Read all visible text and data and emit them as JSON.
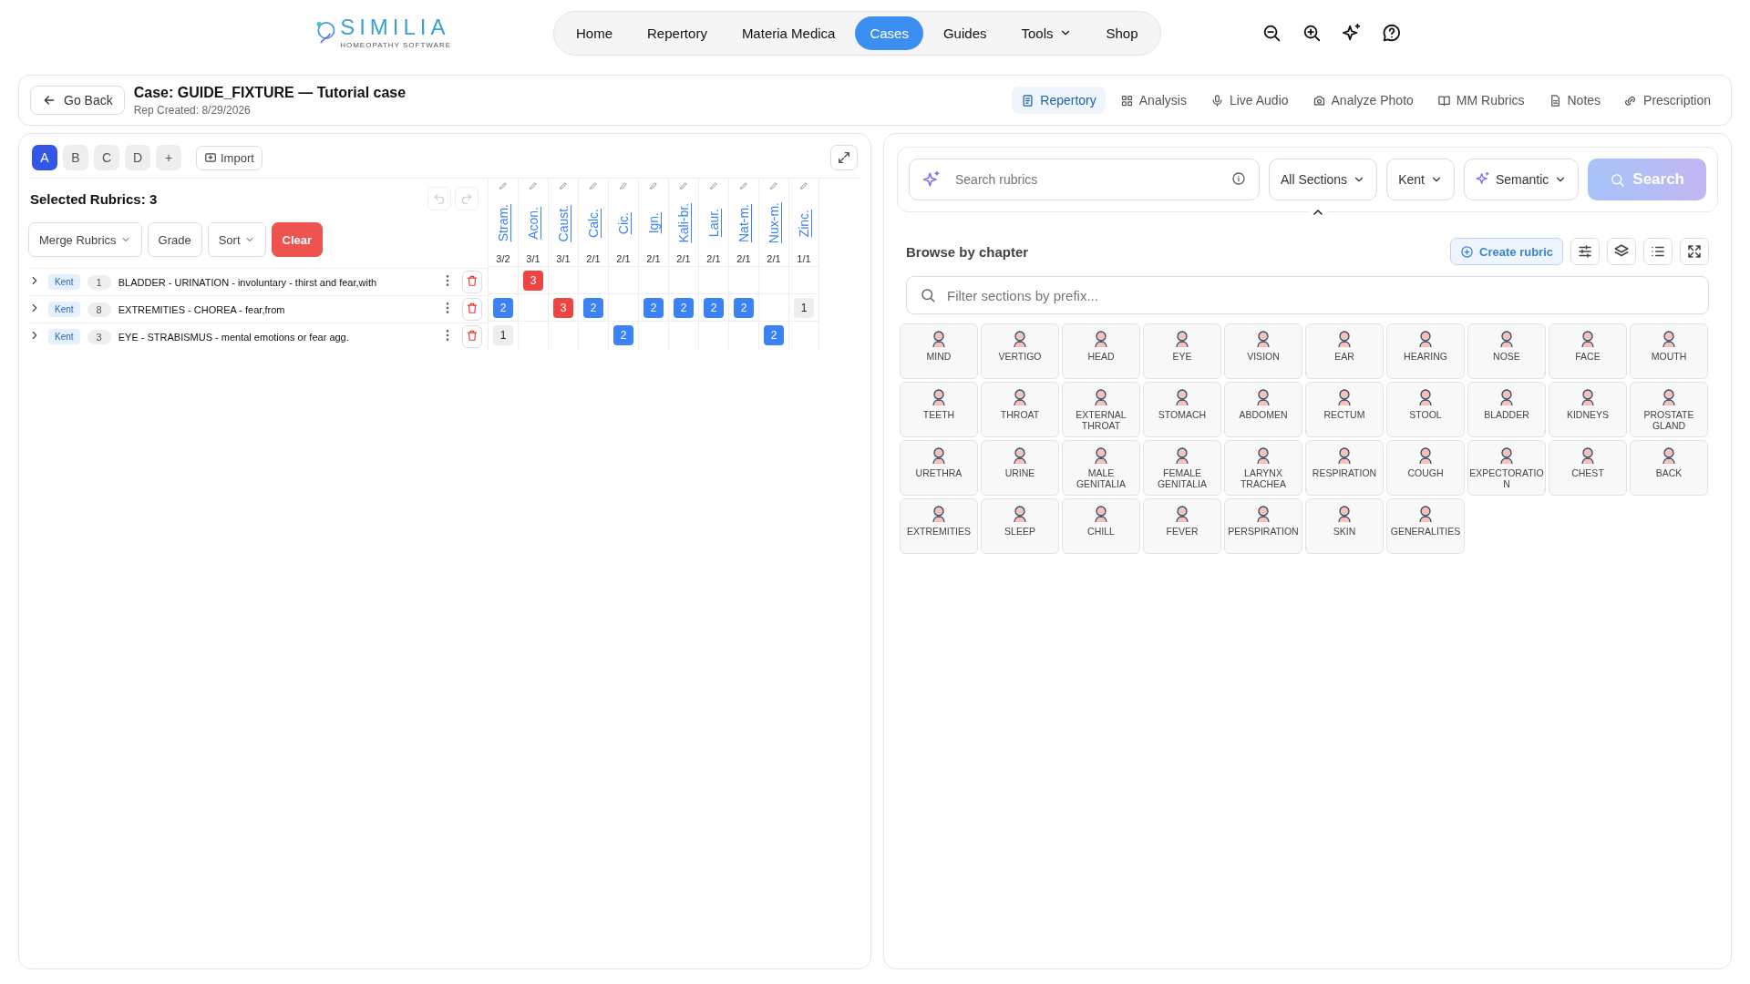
{
  "logo": {
    "name": "SIMILIA",
    "tagline": "HOMEOPATHY SOFTWARE"
  },
  "nav": [
    {
      "label": "Home",
      "selected": false,
      "menu": false
    },
    {
      "label": "Repertory",
      "selected": false,
      "menu": false
    },
    {
      "label": "Materia Medica",
      "selected": false,
      "menu": false
    },
    {
      "label": "Cases",
      "selected": true,
      "menu": false
    },
    {
      "label": "Guides",
      "selected": false,
      "menu": false
    },
    {
      "label": "Tools",
      "selected": false,
      "menu": true
    },
    {
      "label": "Shop",
      "selected": false,
      "menu": false
    }
  ],
  "case": {
    "back": "Go Back",
    "title": "Case: GUIDE_FIXTURE — Tutorial case",
    "created": "Rep Created: 8/29/2026",
    "tabs": [
      {
        "label": "Repertory",
        "selected": true
      },
      {
        "label": "Analysis",
        "selected": false
      },
      {
        "label": "Live Audio",
        "selected": false
      },
      {
        "label": "Analyze Photo",
        "selected": false
      },
      {
        "label": "MM Rubrics",
        "selected": false
      },
      {
        "label": "Notes",
        "selected": false
      },
      {
        "label": "Prescription",
        "selected": false
      }
    ]
  },
  "sheets": [
    {
      "label": "A",
      "selected": true
    },
    {
      "label": "B",
      "selected": false
    },
    {
      "label": "C",
      "selected": false
    },
    {
      "label": "D",
      "selected": false
    }
  ],
  "add_sheet": "+",
  "import": "Import",
  "selected_rubrics": "Selected Rubrics: 3",
  "actions": {
    "merge": "Merge Rubrics",
    "grade": "Grade",
    "sort": "Sort",
    "clear": "Clear"
  },
  "remedies": [
    {
      "name": "Stram.",
      "score": "3/2"
    },
    {
      "name": "Acon.",
      "score": "3/1"
    },
    {
      "name": "Caust.",
      "score": "3/1"
    },
    {
      "name": "Calc.",
      "score": "2/1"
    },
    {
      "name": "Cic.",
      "score": "2/1"
    },
    {
      "name": "Ign.",
      "score": "2/1"
    },
    {
      "name": "Kali-br.",
      "score": "2/1"
    },
    {
      "name": "Laur.",
      "score": "2/1"
    },
    {
      "name": "Nat-m.",
      "score": "2/1"
    },
    {
      "name": "Nux-m.",
      "score": "2/1"
    },
    {
      "name": "Zinc.",
      "score": "1/1"
    }
  ],
  "rubrics": [
    {
      "repertory": "Kent",
      "count": "1",
      "text": "BLADDER - URINATION - involuntary - thirst and fear,with",
      "cells": [
        null,
        {
          "value": "3",
          "color": "#ef4444"
        },
        null,
        null,
        null,
        null,
        null,
        null,
        null,
        null,
        null
      ]
    },
    {
      "repertory": "Kent",
      "count": "8",
      "text": "EXTREMITIES - CHOREA - fear,from",
      "cells": [
        {
          "value": "2",
          "color": "#3b82f6"
        },
        null,
        {
          "value": "3",
          "color": "#ef4444"
        },
        {
          "value": "2",
          "color": "#3b82f6"
        },
        null,
        {
          "value": "2",
          "color": "#3b82f6"
        },
        {
          "value": "2",
          "color": "#3b82f6"
        },
        {
          "value": "2",
          "color": "#3b82f6"
        },
        {
          "value": "2",
          "color": "#3b82f6"
        },
        null,
        {
          "value": "1",
          "color": "#eeeeee"
        }
      ]
    },
    {
      "repertory": "Kent",
      "count": "3",
      "text": "EYE - STRABISMUS - mental emotions or fear agg.",
      "cells": [
        {
          "value": "1",
          "color": "#eeeeee"
        },
        null,
        null,
        null,
        {
          "value": "2",
          "color": "#3b82f6"
        },
        null,
        null,
        null,
        null,
        {
          "value": "2",
          "color": "#3b82f6"
        },
        null
      ]
    }
  ],
  "search": {
    "placeholder": "Search rubrics",
    "section": "All Sections",
    "repertory": "Kent",
    "mode": "Semantic",
    "button": "Search"
  },
  "browse": {
    "title": "Browse by chapter",
    "create": "Create rubric",
    "filter_placeholder": "Filter sections by prefix...",
    "chapters": [
      "MIND",
      "VERTIGO",
      "HEAD",
      "EYE",
      "VISION",
      "EAR",
      "HEARING",
      "NOSE",
      "FACE",
      "MOUTH",
      "TEETH",
      "THROAT",
      "EXTERNAL THROAT",
      "STOMACH",
      "ABDOMEN",
      "RECTUM",
      "STOOL",
      "BLADDER",
      "KIDNEYS",
      "PROSTATE GLAND",
      "URETHRA",
      "URINE",
      "MALE GENITALIA",
      "FEMALE GENITALIA",
      "LARYNX TRACHEA",
      "RESPIRATION",
      "COUGH",
      "EXPECTORATIO N",
      "CHEST",
      "BACK",
      "EXTREMITIES",
      "SLEEP",
      "CHILL",
      "FEVER",
      "PERSPIRATION",
      "SKIN",
      "GENERALITIES"
    ]
  }
}
